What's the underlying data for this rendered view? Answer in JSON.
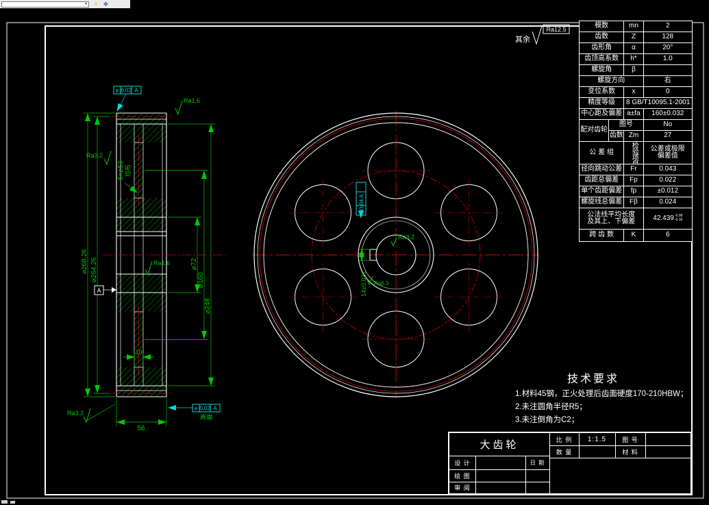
{
  "app": {
    "toolbar": {
      "dropdown_value": "",
      "bolt_icon_glyph": "⚡",
      "diamond_icon_glyph": "❖"
    }
  },
  "surface_note": {
    "prefix": "其余",
    "roughness": "Ra12.5"
  },
  "gear_table": {
    "rows": [
      {
        "label": "模数",
        "sym": "mn",
        "val": "2"
      },
      {
        "label": "齿数",
        "sym": "Z",
        "val": "128"
      },
      {
        "label": "齿形角",
        "sym": "α",
        "val": "20°"
      },
      {
        "label": "齿顶高系数",
        "sym": "h*",
        "val": "1.0"
      },
      {
        "label": "螺旋角",
        "sym": "β",
        "val": ""
      },
      {
        "label": "螺旋方向",
        "sym": "",
        "val": "右"
      },
      {
        "label": "变位系数",
        "sym": "x",
        "val": "0"
      },
      {
        "label": "精度等级",
        "sym": "",
        "val": "8 GB/T10095.1-2001"
      },
      {
        "label": "中心距及偏差",
        "sym": "a±fa",
        "val": "160±0.032"
      }
    ],
    "paired": {
      "label": "配对齿轮",
      "row1_label": "图号",
      "row1_val": "No",
      "row2_label": "齿数",
      "row2_sym": "Zm",
      "row2_val": "27"
    },
    "tol_header": {
      "group": "公 差 组",
      "item": "检验项目代号",
      "value_line1": "公差或极限",
      "value_line2": "偏差值"
    },
    "tol_rows": [
      {
        "label": "径向跳动公差",
        "sym": "Fr",
        "val": "0.043"
      },
      {
        "label": "齿距总偏差",
        "sym": "Fp",
        "val": "0.022"
      },
      {
        "label": "单个齿距偏差",
        "sym": "fp",
        "val": "±0.012"
      },
      {
        "label": "螺旋线总偏差",
        "sym": "Fβ",
        "val": "0.024"
      }
    ],
    "normal_length": {
      "label_line1": "公法线平均长度",
      "label_line2": "及其上、下偏差",
      "val": "42.439",
      "upper_dev": "-0.08",
      "lower_dev": "-0.16"
    },
    "span_teeth": {
      "label": "跨 齿 数",
      "sym": "K",
      "val": "6"
    }
  },
  "tech": {
    "title": "技术要求",
    "lines": [
      "1.材料45钢，正火处理后齿面硬度170-210HBW；",
      "2.未注圆角半径R5；",
      "3.未注倒角为C2；"
    ]
  },
  "title_block": {
    "part_name": "大齿轮",
    "scale_label": "比 例",
    "scale_val": "1:1.5",
    "drawing_no_label": "图 号",
    "qty_label": "数 量",
    "material_label": "材 料",
    "design_label": "设 计",
    "draw_label": "绘 图",
    "review_label": "审 阅",
    "date_label": "日 期"
  },
  "dims": {
    "od": "⌀268.26",
    "pitch": "⌀264.26",
    "hub": "⌀72",
    "bolt_circle": "⌀160",
    "rim": "⌀248",
    "holes": "6×⌀53",
    "holes_note": "均布",
    "web_thickness": "10",
    "face_width": "56",
    "keyway": "14±0.021",
    "ra16": "Ra1.6",
    "ra32": "Ra3.2",
    "ra63": "Ra6.3",
    "datum": "A"
  },
  "frames": {
    "face_sym": "⌀",
    "face_val": "0.02",
    "face_datum": "A",
    "face_note": "两端",
    "hub_frame": "⌀0.04 A"
  }
}
